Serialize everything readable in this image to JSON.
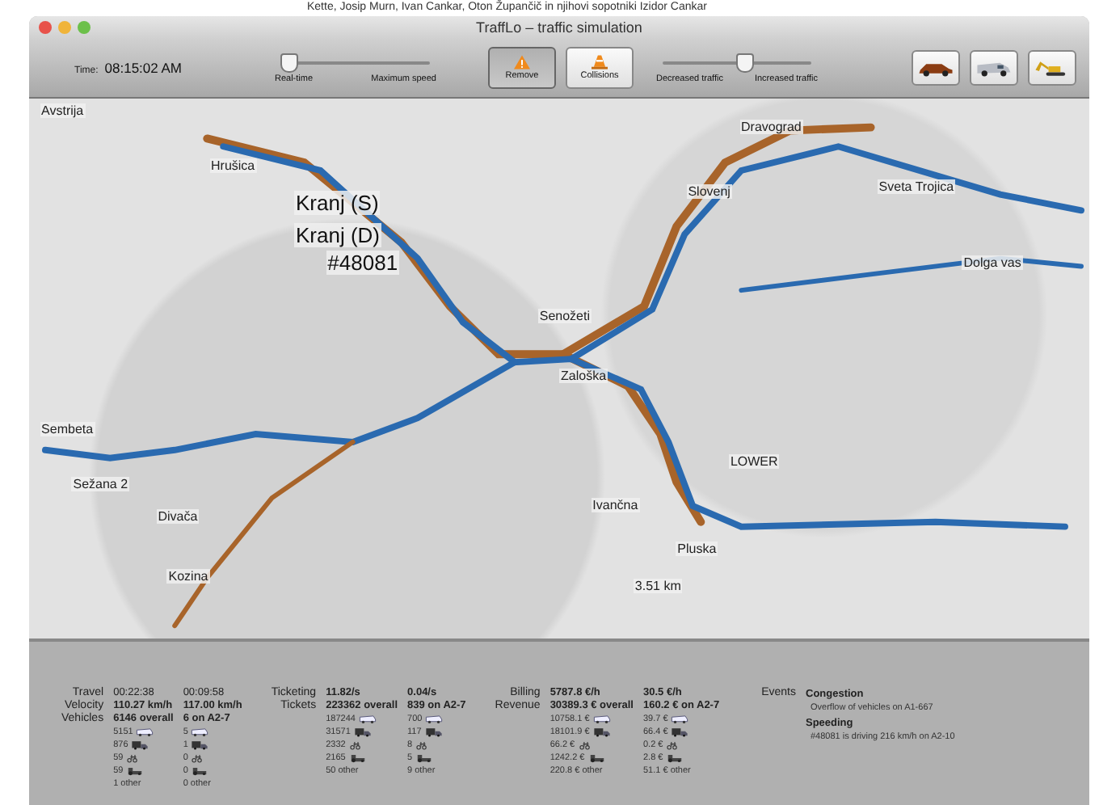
{
  "background_text": "Kette, Josip Murn, Ivan Cankar, Oton Župančič in njihovi sopotniki Izidor Cankar",
  "window": {
    "title": "TraffLo – traffic simulation"
  },
  "time": {
    "label": "Time:",
    "value": "08:15:02 AM"
  },
  "speed_slider": {
    "level": 0.05,
    "min_label": "Real-time",
    "max_label": "Maximum speed"
  },
  "buttons": [
    {
      "label": "Remove",
      "kind": "warning",
      "selected": true
    },
    {
      "label": "Collisions",
      "kind": "cone",
      "selected": false
    }
  ],
  "traffic_slider": {
    "level": 0.55,
    "min_label": "Decreased traffic",
    "max_label": "Increased traffic"
  },
  "vehicle_buttons": [
    {
      "kind": "car"
    },
    {
      "kind": "van"
    },
    {
      "kind": "excavator"
    }
  ],
  "map": {
    "labels": [
      {
        "text": "Avstrija",
        "kind": "place"
      },
      {
        "text": "Hrušica",
        "kind": "place"
      },
      {
        "text": "Kranj (S)",
        "kind": "marker"
      },
      {
        "text": "Kranj (D)",
        "kind": "marker"
      },
      {
        "text": "#48081",
        "kind": "marker"
      },
      {
        "text": "Dravograd",
        "kind": "place"
      },
      {
        "text": "Slovenj",
        "kind": "place"
      },
      {
        "text": "Sveta Trojica",
        "kind": "place"
      },
      {
        "text": "Dolga vas",
        "kind": "place"
      },
      {
        "text": "Senožeti",
        "kind": "place"
      },
      {
        "text": "Zaloška",
        "kind": "place"
      },
      {
        "text": "Sembeta",
        "kind": "place"
      },
      {
        "text": "LOWER",
        "kind": "place"
      },
      {
        "text": "Sežana 2",
        "kind": "place"
      },
      {
        "text": "Divača",
        "kind": "place"
      },
      {
        "text": "Ivančna",
        "kind": "place"
      },
      {
        "text": "Pluska",
        "kind": "place"
      },
      {
        "text": "Kozina",
        "kind": "place"
      },
      {
        "text": "3.51 km",
        "kind": "place"
      }
    ]
  },
  "stats": [
    {
      "rows": [
        {
          "label": "Travel",
          "values": [
            "00:22:38",
            "00:09:58"
          ],
          "kind": "time"
        },
        {
          "label": "Velocity",
          "values": [
            "110.27 km/h",
            "117.00 km/h"
          ],
          "kind": "figure"
        },
        {
          "label": "Vehicles",
          "values": [
            "6146 overall",
            "6 on A2-7"
          ],
          "kind": "figure"
        }
      ],
      "breakdown": [
        {
          "kind": "bus",
          "values": [
            "5151",
            "5"
          ]
        },
        {
          "kind": "truck",
          "values": [
            "876",
            "1"
          ]
        },
        {
          "kind": "bike",
          "values": [
            "59",
            "0"
          ]
        },
        {
          "kind": "tractor",
          "values": [
            "59",
            "0"
          ]
        },
        {
          "kind": "text",
          "values": [
            "1 other",
            "0 other"
          ]
        }
      ]
    },
    {
      "rows": [
        {
          "label": "Ticketing",
          "values": [
            "11.82/s",
            "0.04/s"
          ],
          "kind": "figure"
        },
        {
          "label": "Tickets",
          "values": [
            "223362 overall",
            "839 on A2-7"
          ],
          "kind": "figure"
        }
      ],
      "breakdown": [
        {
          "kind": "bus",
          "values": [
            "187244",
            "700"
          ]
        },
        {
          "kind": "truck",
          "values": [
            "31571",
            "117"
          ]
        },
        {
          "kind": "bike",
          "values": [
            "2332",
            "8"
          ]
        },
        {
          "kind": "tractor",
          "values": [
            "2165",
            "5"
          ]
        },
        {
          "kind": "text",
          "values": [
            "50 other",
            "9 other"
          ]
        }
      ]
    },
    {
      "rows": [
        {
          "label": "Billing",
          "values": [
            "5787.8 €/h",
            "30.5 €/h"
          ],
          "kind": "figure"
        },
        {
          "label": "Revenue",
          "values": [
            "30389.3 € overall",
            "160.2 € on A2-7"
          ],
          "kind": "figure"
        }
      ],
      "breakdown": [
        {
          "kind": "bus",
          "values": [
            "10758.1 €",
            "39.7 €"
          ]
        },
        {
          "kind": "truck",
          "values": [
            "18101.9 €",
            "66.4 €"
          ]
        },
        {
          "kind": "bike",
          "values": [
            "66.2 €",
            "0.2 €"
          ]
        },
        {
          "kind": "tractor",
          "values": [
            "1242.2 €",
            "2.8 €"
          ]
        },
        {
          "kind": "text",
          "values": [
            "220.8 € other",
            "51.1 € other"
          ]
        }
      ]
    }
  ],
  "events": {
    "label": "Events",
    "items": [
      {
        "title": "Congestion",
        "detail": "Overflow of vehicles on A1-667"
      },
      {
        "title": "Speeding",
        "detail": "#48081 is driving 216 km/h on A2-10"
      }
    ]
  }
}
